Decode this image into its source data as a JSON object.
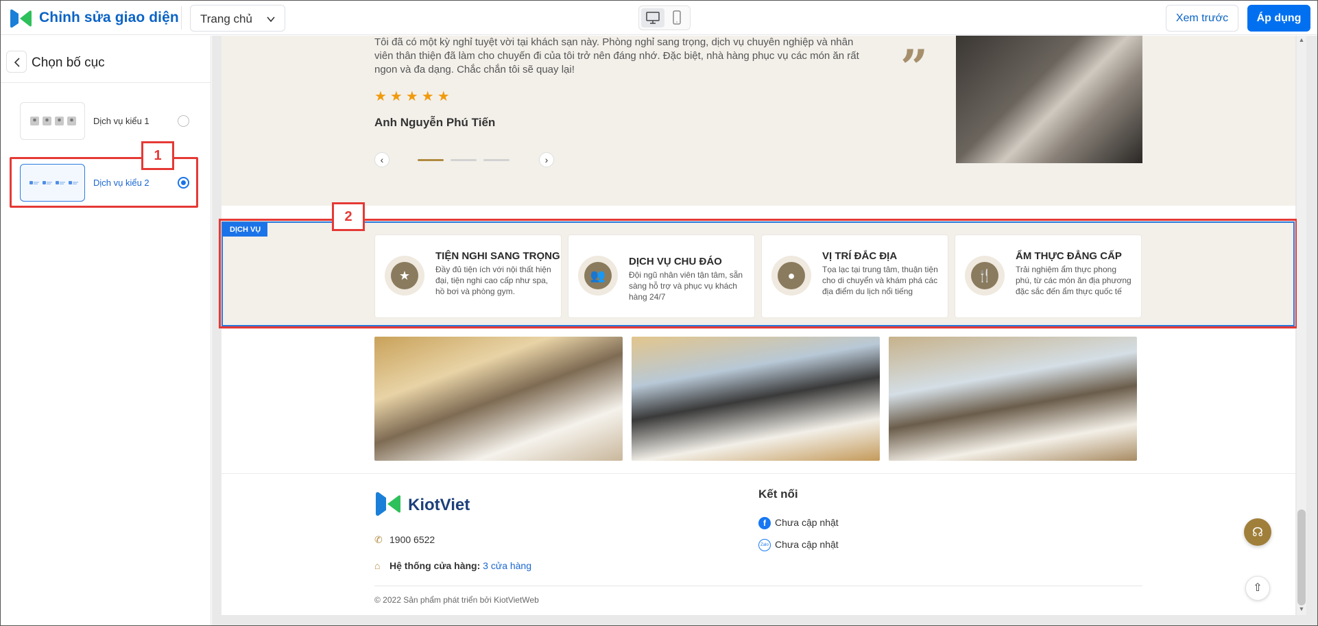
{
  "header": {
    "app_title": "Chỉnh sửa giao diện",
    "page_select": "Trang chủ",
    "preview_label": "Xem trước",
    "apply_label": "Áp dụng"
  },
  "left_panel": {
    "title": "Chọn bố cục",
    "options": [
      {
        "label": "Dịch vụ kiểu 1",
        "selected": false
      },
      {
        "label": "Dịch vụ kiểu 2",
        "selected": true
      }
    ]
  },
  "annotations": {
    "badge1": "1",
    "badge2": "2",
    "color": "#e53935"
  },
  "testimonial": {
    "quote": "Tôi đã có một kỳ nghỉ tuyệt vời tại khách sạn này. Phòng nghỉ sang trọng, dịch vụ chuyên nghiệp và nhân viên thân thiện đã làm cho chuyến đi của tôi trở nên đáng nhớ. Đặc biệt, nhà hàng phục vụ các món ăn rất ngon và đa dạng. Chắc chắn tôi sẽ quay lại!",
    "stars": "★★★★★",
    "rating": 5,
    "author": "Anh Nguyễn Phú Tiến"
  },
  "services": {
    "tag": "DỊCH VỤ",
    "items": [
      {
        "title": "TIỆN NGHI SANG TRỌNG",
        "desc": "Đầy đủ tiện ích với nội thất hiện đại, tiện nghi cao cấp như spa, hồ bơi và phòng gym.",
        "icon": "star-icon"
      },
      {
        "title": "DỊCH VỤ CHU ĐÁO",
        "desc": "Đội ngũ nhân viên tận tâm, sẵn sàng hỗ trợ và phục vụ khách hàng 24/7",
        "icon": "users-icon"
      },
      {
        "title": "VỊ TRÍ ĐẮC ĐỊA",
        "desc": "Tọa lạc tại trung tâm, thuận tiện cho di chuyển và khám phá các địa điểm du lịch nổi tiếng",
        "icon": "location-icon"
      },
      {
        "title": "ẨM THỰC ĐẲNG CẤP",
        "desc": "Trải nghiệm ẩm thực phong phú, từ các món ăn địa phương đặc sắc đến ẩm thực quốc tế",
        "icon": "dining-icon"
      }
    ]
  },
  "footer": {
    "brand": "KiotViet",
    "phone": "1900 6522",
    "stores_label": "Hệ thống cửa hàng:",
    "stores_link": "3 cửa hàng",
    "connect_title": "Kết nối",
    "facebook": "Chưa cập nhật",
    "zalo": "Chưa cập nhật",
    "zalo_icon_text": "Zalo",
    "copyright": "© 2022 Sản phẩm phát triển bởi KiotVietWeb"
  },
  "colors": {
    "accent": "#0070f0",
    "brand_gold": "#b08a3e",
    "star": "#f19a0e"
  }
}
